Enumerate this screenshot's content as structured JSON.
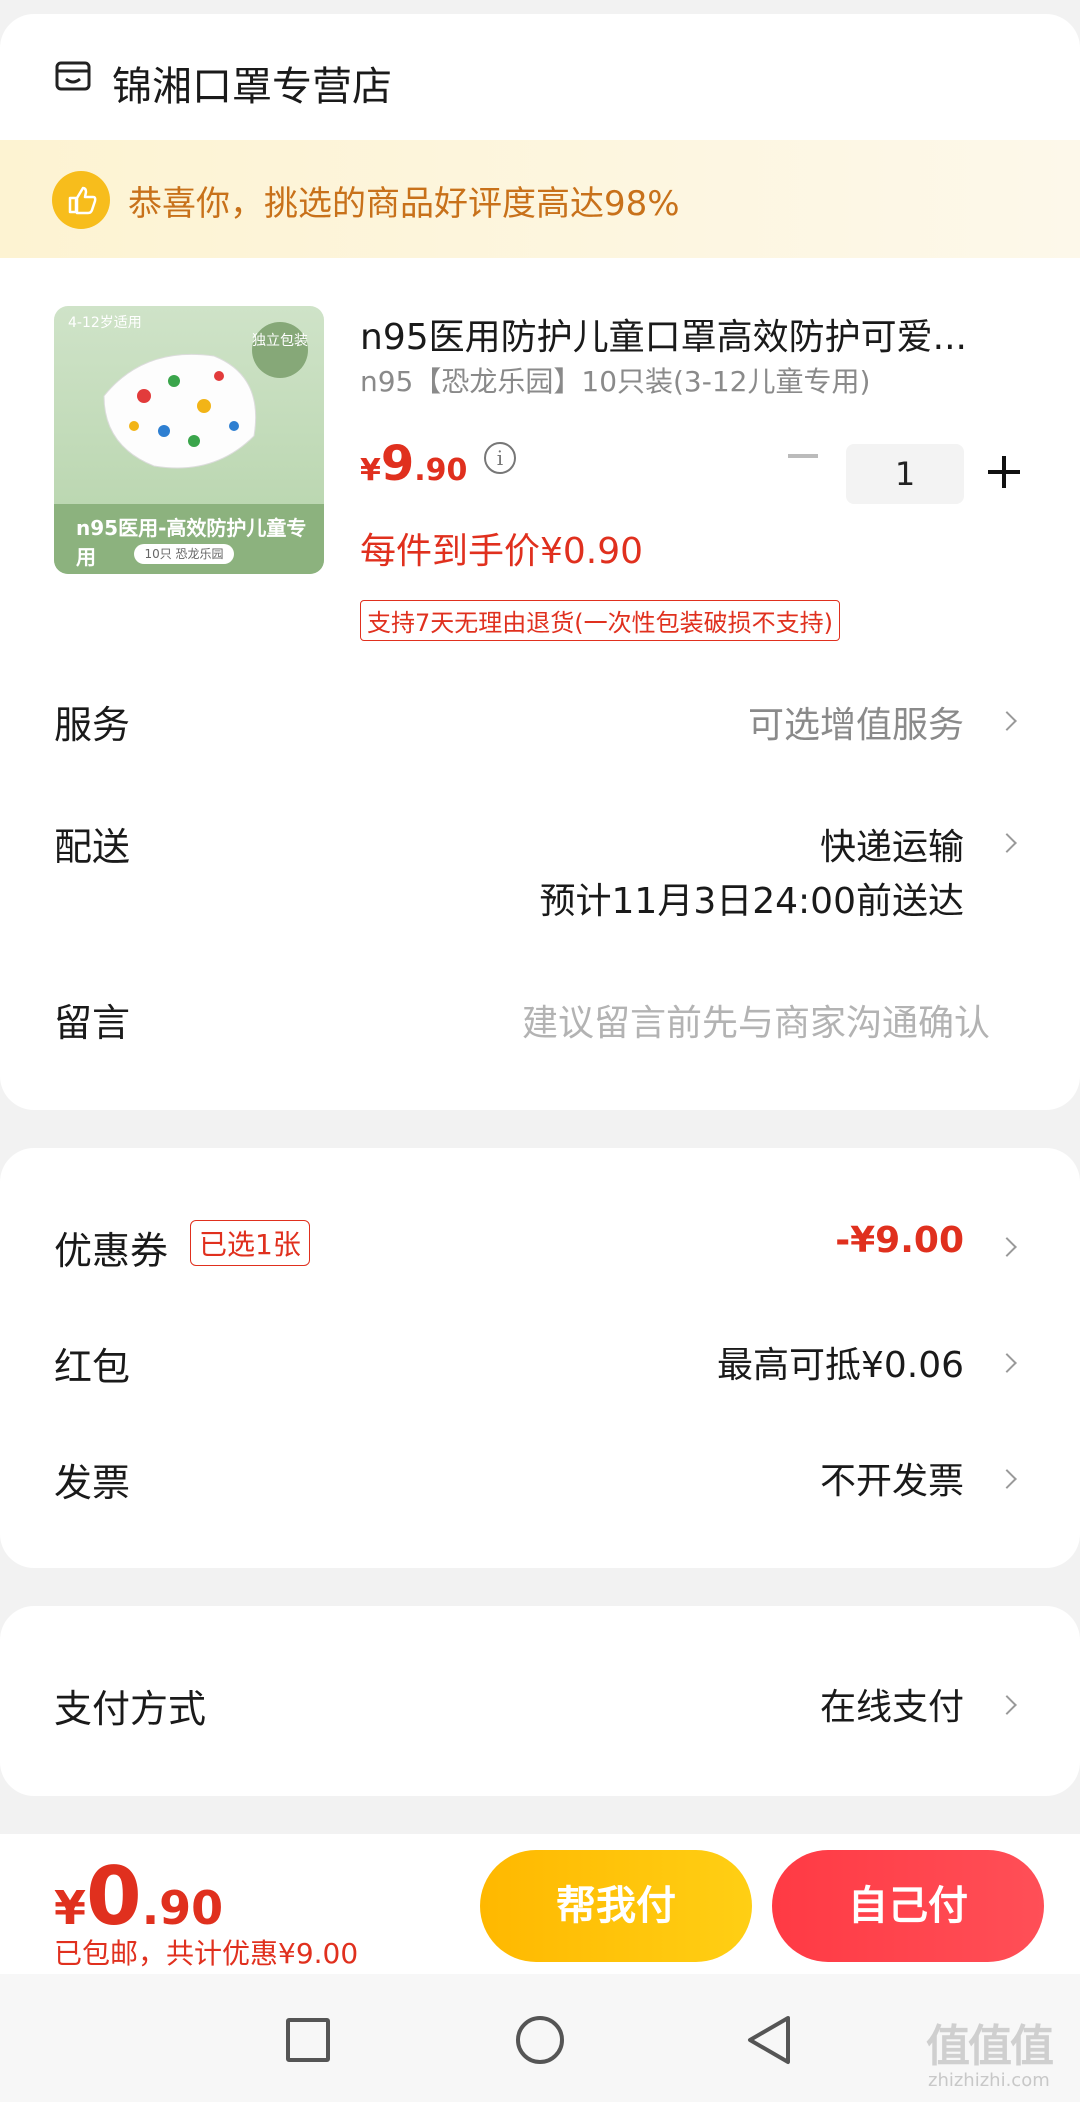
{
  "store": {
    "name": "锦湘口罩专营店",
    "icon": "store-icon"
  },
  "banner": {
    "text": "恭喜你，挑选的商品好评度高达98%",
    "icon": "thumbs-up-icon"
  },
  "product": {
    "image_tag": "4-12岁适用",
    "image_badge": "独立包装",
    "image_title": "n95医用-高效防护儿童专用",
    "image_sub": "10只 恐龙乐园",
    "title": "n95医用防护儿童口罩高效防护可爱...",
    "sku": "n95【恐龙乐园】10只装(3-12儿童专用)",
    "price": {
      "currency": "¥",
      "int": "9",
      "dec": ".90"
    },
    "quantity": "1",
    "unit_price": "每件到手价¥0.90",
    "return_policy": "支持7天无理由退货(一次性包装破损不支持)"
  },
  "rows": {
    "service": {
      "label": "服务",
      "value": "可选增值服务"
    },
    "delivery": {
      "label": "配送",
      "value": "快递运输",
      "eta": "预计11月3日24:00前送达"
    },
    "message": {
      "label": "留言",
      "placeholder": "建议留言前先与商家沟通确认"
    },
    "coupon": {
      "label": "优惠券",
      "tag": "已选1张",
      "value": "-¥9.00"
    },
    "redpacket": {
      "label": "红包",
      "value": "最高可抵¥0.06"
    },
    "invoice": {
      "label": "发票",
      "value": "不开发票"
    },
    "payment": {
      "label": "支付方式",
      "value": "在线支付"
    }
  },
  "bottom": {
    "total": {
      "currency": "¥",
      "int": "0",
      "dec": ".90"
    },
    "note": "已包邮，共计优惠¥9.00",
    "help_pay": "帮我付",
    "self_pay": "自己付"
  },
  "watermark": {
    "main": "值值值",
    "sub": "zhizhizhi.com"
  },
  "colors": {
    "accent": "#e0301e",
    "help_button": "#ffc107",
    "self_button": "#ff4049",
    "banner_text": "#c8711a"
  }
}
